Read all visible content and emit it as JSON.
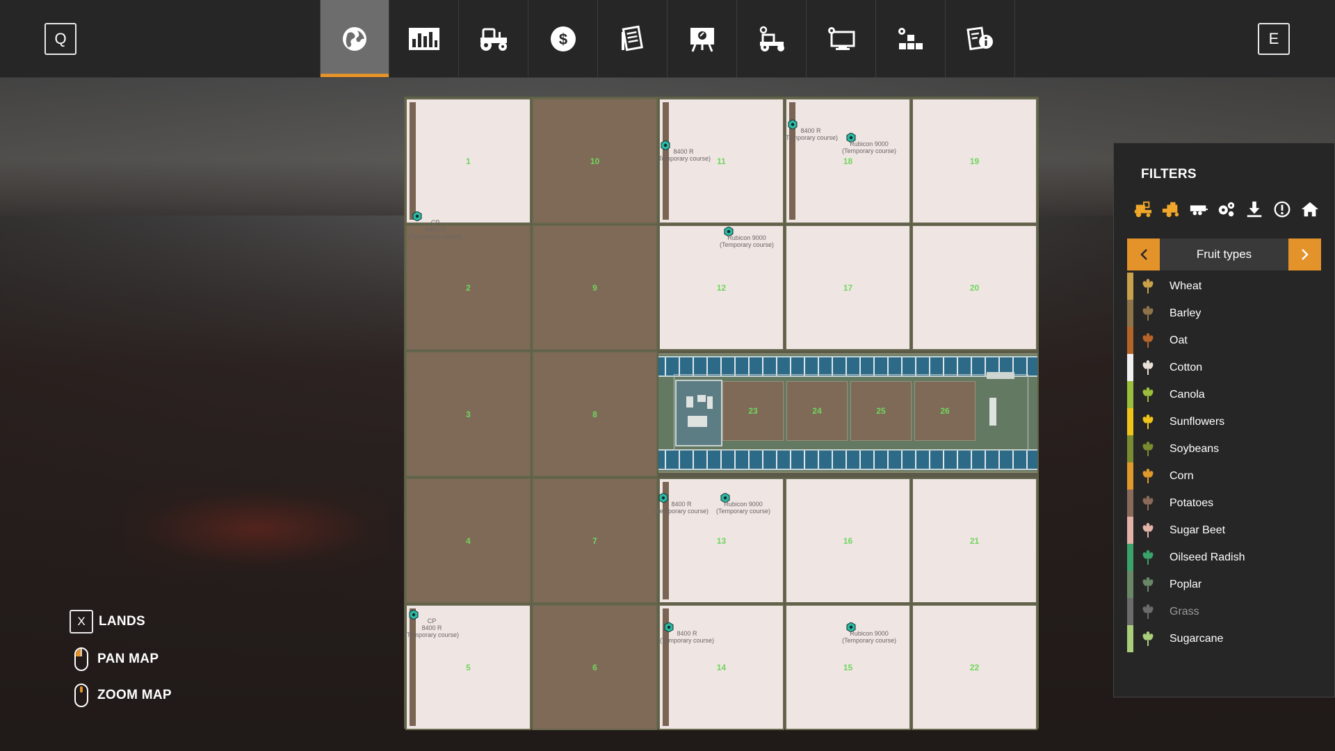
{
  "topbar": {
    "left_key": "Q",
    "right_key": "E",
    "active_tab": 0,
    "tabs": [
      {
        "icon": "globe-map-icon"
      },
      {
        "icon": "statistics-chart-icon"
      },
      {
        "icon": "tractor-icon"
      },
      {
        "icon": "dollar-finance-icon"
      },
      {
        "icon": "contracts-icon"
      },
      {
        "icon": "tutorial-board-icon"
      },
      {
        "icon": "animals-vehicle-icon"
      },
      {
        "icon": "settings-monitor-icon"
      },
      {
        "icon": "production-icon"
      },
      {
        "icon": "help-info-icon"
      }
    ]
  },
  "map": {
    "fields": [
      {
        "num": "1",
        "tone": "light"
      },
      {
        "num": "10",
        "tone": "dark"
      },
      {
        "num": "11",
        "tone": "light"
      },
      {
        "num": "18",
        "tone": "light"
      },
      {
        "num": "19",
        "tone": "light"
      },
      {
        "num": "2",
        "tone": "dark"
      },
      {
        "num": "9",
        "tone": "dark"
      },
      {
        "num": "12",
        "tone": "light"
      },
      {
        "num": "17",
        "tone": "light"
      },
      {
        "num": "20",
        "tone": "light"
      },
      {
        "num": "3",
        "tone": "dark"
      },
      {
        "num": "8",
        "tone": "dark"
      },
      {
        "num": "4",
        "tone": "dark"
      },
      {
        "num": "7",
        "tone": "dark"
      },
      {
        "num": "13",
        "tone": "light"
      },
      {
        "num": "16",
        "tone": "light"
      },
      {
        "num": "21",
        "tone": "light"
      },
      {
        "num": "5",
        "tone": "light"
      },
      {
        "num": "6",
        "tone": "dark"
      },
      {
        "num": "14",
        "tone": "light"
      },
      {
        "num": "15",
        "tone": "light"
      },
      {
        "num": "22",
        "tone": "light"
      }
    ],
    "plots": [
      "23",
      "24",
      "25",
      "26"
    ],
    "markers": [
      {
        "line1": "CP",
        "line2": "8400 R",
        "line3": "(Temporary course)"
      },
      {
        "line1": "",
        "line2": "8400 R",
        "line3": "(Temporary course)"
      },
      {
        "line1": "",
        "line2": "8400 R",
        "line3": "(Temporary course)"
      },
      {
        "line1": "",
        "line2": "Rubicon 9000",
        "line3": "(Temporary course)"
      },
      {
        "line1": "",
        "line2": "Rubicon 9000",
        "line3": "(Temporary course)"
      },
      {
        "line1": "",
        "line2": "8400 R",
        "line3": "(Temporary course)"
      },
      {
        "line1": "",
        "line2": "Rubicon 9000",
        "line3": "(Temporary course)"
      },
      {
        "line1": "CP",
        "line2": "8400 R",
        "line3": "(Temporary course)"
      },
      {
        "line1": "",
        "line2": "8400 R",
        "line3": "(Temporary course)"
      },
      {
        "line1": "",
        "line2": "Rubicon 9000",
        "line3": "(Temporary course)"
      }
    ]
  },
  "controls": {
    "lands_key": "X",
    "lands": "LANDS",
    "pan": "PAN MAP",
    "zoom": "ZOOM MAP"
  },
  "filters": {
    "title": "FILTERS",
    "icons": [
      "combine-icon",
      "harvester-icon",
      "trailer-icon",
      "gears-icon",
      "download-icon",
      "warning-icon",
      "home-icon"
    ],
    "selector": "Fruit types",
    "fruits": [
      {
        "name": "Wheat",
        "color": "#c9a14a",
        "icon": "wheat-icon"
      },
      {
        "name": "Barley",
        "color": "#8e7448",
        "icon": "barley-icon"
      },
      {
        "name": "Oat",
        "color": "#b7642a",
        "icon": "oat-icon"
      },
      {
        "name": "Cotton",
        "color": "#f1f1f1",
        "icon": "cotton-icon"
      },
      {
        "name": "Canola",
        "color": "#9bbf3a",
        "icon": "canola-icon"
      },
      {
        "name": "Sunflowers",
        "color": "#f0c419",
        "icon": "sunflower-icon"
      },
      {
        "name": "Soybeans",
        "color": "#7a8c30",
        "icon": "soybean-icon"
      },
      {
        "name": "Corn",
        "color": "#e09a2c",
        "icon": "corn-icon"
      },
      {
        "name": "Potatoes",
        "color": "#8a6a5a",
        "icon": "potato-icon"
      },
      {
        "name": "Sugar Beet",
        "color": "#e2b3a6",
        "icon": "sugar-beet-icon"
      },
      {
        "name": "Oilseed Radish",
        "color": "#3aa36a",
        "icon": "oilseed-radish-icon"
      },
      {
        "name": "Poplar",
        "color": "#6a8868",
        "icon": "poplar-icon"
      },
      {
        "name": "Grass",
        "color": "#6b6b6b",
        "icon": "grass-icon"
      },
      {
        "name": "Sugarcane",
        "color": "#a9cf7a",
        "icon": "sugarcane-icon"
      }
    ]
  }
}
